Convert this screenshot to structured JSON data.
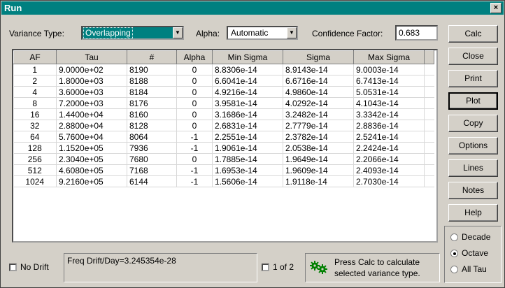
{
  "window": {
    "title": "Run",
    "close_glyph": "×"
  },
  "controls": {
    "variance_type_label": "Variance Type:",
    "variance_type_value": "Overlapping",
    "alpha_label": "Alpha:",
    "alpha_value": "Automatic",
    "confidence_label": "Confidence Factor:",
    "confidence_value": "0.683"
  },
  "table": {
    "columns": [
      "AF",
      "Tau",
      "#",
      "Alpha",
      "Min Sigma",
      "Sigma",
      "Max Sigma"
    ],
    "rows": [
      [
        "1",
        "9.0000e+02",
        "8190",
        "0",
        "8.8306e-14",
        "8.9143e-14",
        "9.0003e-14"
      ],
      [
        "2",
        "1.8000e+03",
        "8188",
        "0",
        "6.6041e-14",
        "6.6716e-14",
        "6.7413e-14"
      ],
      [
        "4",
        "3.6000e+03",
        "8184",
        "0",
        "4.9216e-14",
        "4.9860e-14",
        "5.0531e-14"
      ],
      [
        "8",
        "7.2000e+03",
        "8176",
        "0",
        "3.9581e-14",
        "4.0292e-14",
        "4.1043e-14"
      ],
      [
        "16",
        "1.4400e+04",
        "8160",
        "0",
        "3.1686e-14",
        "3.2482e-14",
        "3.3342e-14"
      ],
      [
        "32",
        "2.8800e+04",
        "8128",
        "0",
        "2.6831e-14",
        "2.7779e-14",
        "2.8836e-14"
      ],
      [
        "64",
        "5.7600e+04",
        "8064",
        "-1",
        "2.2551e-14",
        "2.3782e-14",
        "2.5241e-14"
      ],
      [
        "128",
        "1.1520e+05",
        "7936",
        "-1",
        "1.9061e-14",
        "2.0538e-14",
        "2.2424e-14"
      ],
      [
        "256",
        "2.3040e+05",
        "7680",
        "0",
        "1.7885e-14",
        "1.9649e-14",
        "2.2066e-14"
      ],
      [
        "512",
        "4.6080e+05",
        "7168",
        "-1",
        "1.6953e-14",
        "1.9609e-14",
        "2.4093e-14"
      ],
      [
        "1024",
        "9.2160e+05",
        "6144",
        "-1",
        "1.5606e-14",
        "1.9118e-14",
        "2.7030e-14"
      ]
    ]
  },
  "buttons": [
    "Calc",
    "Close",
    "Print",
    "Plot",
    "Copy",
    "Options",
    "Lines",
    "Notes",
    "Help"
  ],
  "tau_options": [
    {
      "label": "Decade",
      "selected": false
    },
    {
      "label": "Octave",
      "selected": true
    },
    {
      "label": "All Tau",
      "selected": false
    }
  ],
  "bottom": {
    "no_drift_label": "No Drift",
    "freq_drift_text": "Freq Drift/Day=3.245354e-28",
    "page_label": "1 of 2",
    "status_text_line1": "Press Calc to calculate",
    "status_text_line2": "selected variance type.",
    "status_icon": "gears-icon",
    "status_icon_color": "#008000"
  }
}
